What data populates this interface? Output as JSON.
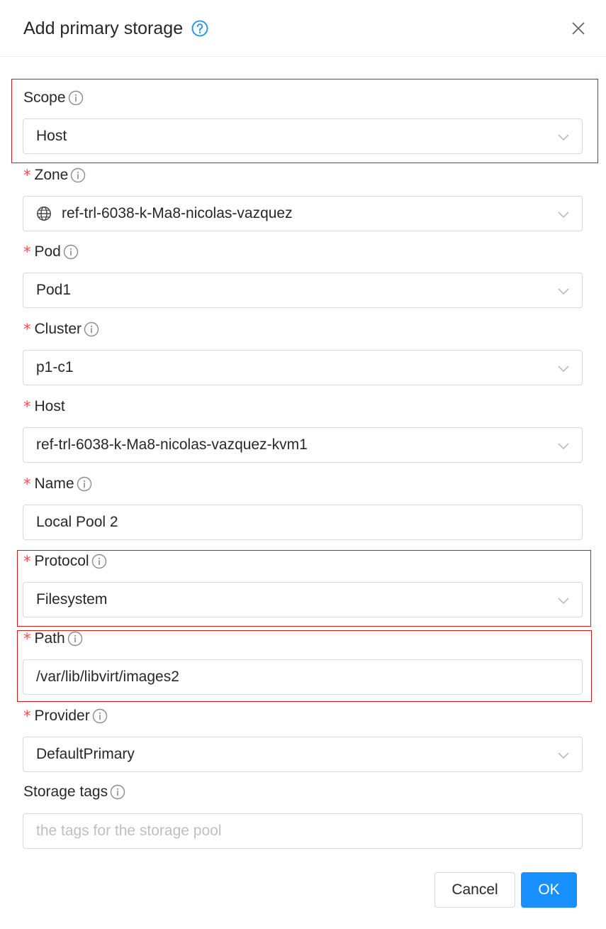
{
  "dialog": {
    "title": "Add primary storage",
    "icons": {
      "help": "question-circle-icon",
      "close": "close-icon",
      "info": "info-circle-icon",
      "dropdown": "chevron-down-icon",
      "zone": "globe-icon"
    },
    "colors": {
      "primary": "#1890ff",
      "required": "#ff4d4f",
      "highlight_box": "#d11a1a",
      "border": "#d9d9d9",
      "placeholder": "#bfbfbf"
    }
  },
  "fields": {
    "scope": {
      "label": "Scope",
      "value": "Host"
    },
    "zone": {
      "label": "Zone",
      "value": "ref-trl-6038-k-Ma8-nicolas-vazquez"
    },
    "pod": {
      "label": "Pod",
      "value": "Pod1"
    },
    "cluster": {
      "label": "Cluster",
      "value": "p1-c1"
    },
    "host": {
      "label": "Host",
      "value": "ref-trl-6038-k-Ma8-nicolas-vazquez-kvm1"
    },
    "name": {
      "label": "Name",
      "value": "Local Pool 2"
    },
    "protocol": {
      "label": "Protocol",
      "value": "Filesystem"
    },
    "path": {
      "label": "Path",
      "value": "/var/lib/libvirt/images2"
    },
    "provider": {
      "label": "Provider",
      "value": "DefaultPrimary"
    },
    "storage_tags": {
      "label": "Storage tags",
      "value": "",
      "placeholder": "the tags for the storage pool"
    }
  },
  "required_marker": "*",
  "footer": {
    "cancel_label": "Cancel",
    "ok_label": "OK"
  }
}
